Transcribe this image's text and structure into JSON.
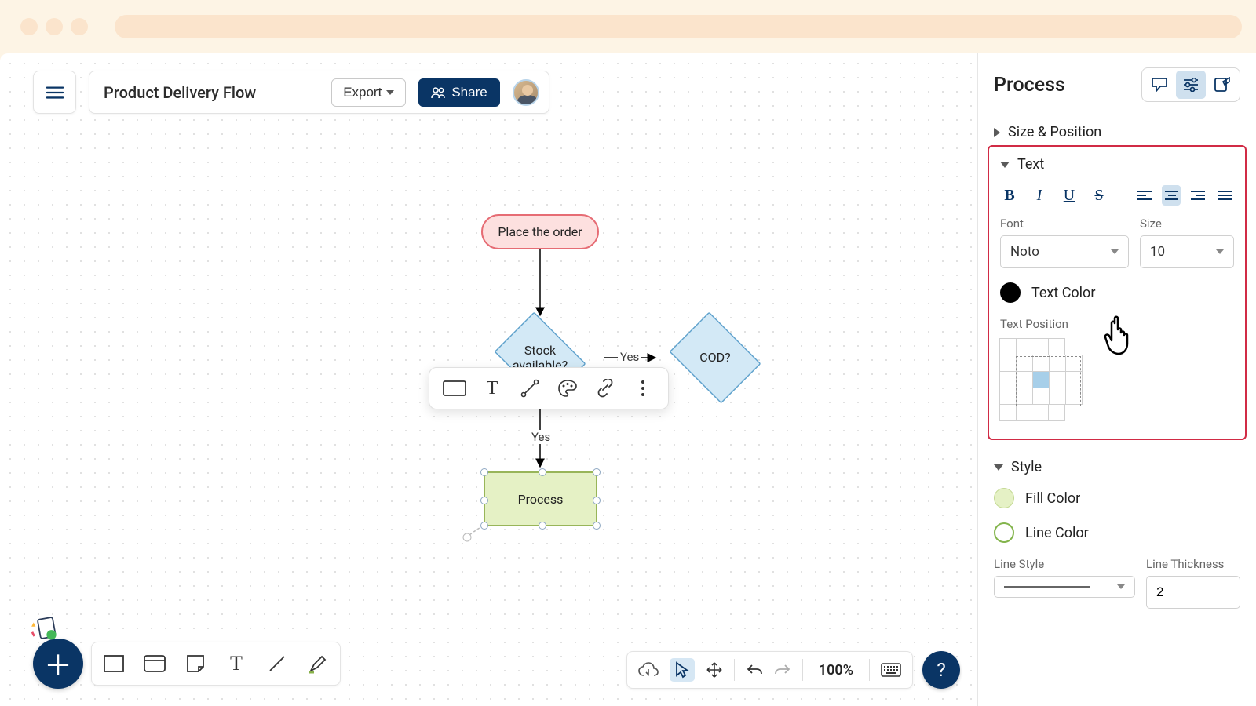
{
  "header": {
    "doc_title": "Product Delivery Flow",
    "export_label": "Export",
    "share_label": "Share"
  },
  "nodes": {
    "place_order": "Place the order",
    "stock": "Stock available?",
    "cod": "COD?",
    "process": "Process"
  },
  "edges": {
    "yes_right": "Yes",
    "yes_down": "Yes"
  },
  "panel": {
    "title": "Process",
    "size_position": "Size & Position",
    "text_heading": "Text",
    "font_label": "Font",
    "font_value": "Noto",
    "size_label": "Size",
    "size_value": "10",
    "text_color": "Text Color",
    "text_position": "Text Position",
    "style_heading": "Style",
    "fill_color": "Fill Color",
    "line_color": "Line Color",
    "line_style": "Line Style",
    "line_thickness": "Line Thickness",
    "thickness_value": "2"
  },
  "footer": {
    "zoom": "100%"
  }
}
